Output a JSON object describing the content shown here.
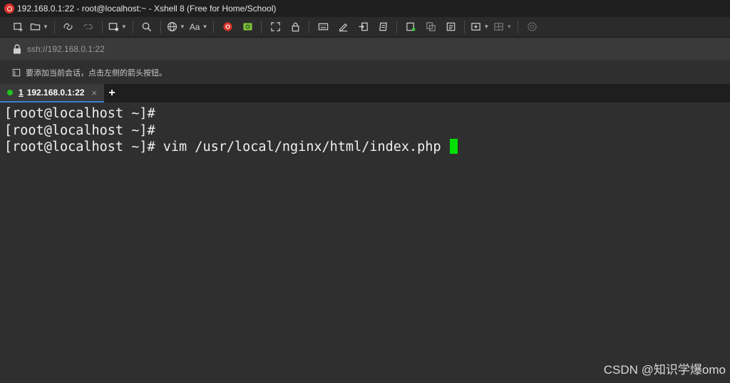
{
  "window": {
    "title": "192.168.0.1:22 - root@localhost:~ - Xshell 8 (Free for Home/School)"
  },
  "toolbar": {
    "font_label": "Aa",
    "icons": [
      "new-session-icon",
      "open-folder-icon",
      "connect-icon",
      "disconnect-icon",
      "new-tab-icon",
      "find-icon",
      "globe-icon",
      "font-icon",
      "xshell-icon",
      "xftp-icon",
      "fullscreen-icon",
      "lock-icon",
      "keyboard-icon",
      "compose-icon",
      "transfer-icon",
      "script-icon",
      "log-icon",
      "copy-icon",
      "paste-icon",
      "new-window-icon",
      "layout-icon",
      "help-icon"
    ]
  },
  "address": {
    "value": "ssh://192.168.0.1:22"
  },
  "hint": {
    "text": "要添加当前会话，点击左侧的箭头按钮。"
  },
  "tabs": [
    {
      "number": "1",
      "label": "192.168.0.1:22",
      "status_color": "#1ec31e",
      "close": "×"
    }
  ],
  "add_tab": "+",
  "terminal": {
    "lines": [
      "[root@localhost ~]#",
      "[root@localhost ~]#",
      "[root@localhost ~]# vim /usr/local/nginx/html/index.php"
    ],
    "cursor_color": "#00e000"
  },
  "watermark": "CSDN @知识学爆omo"
}
